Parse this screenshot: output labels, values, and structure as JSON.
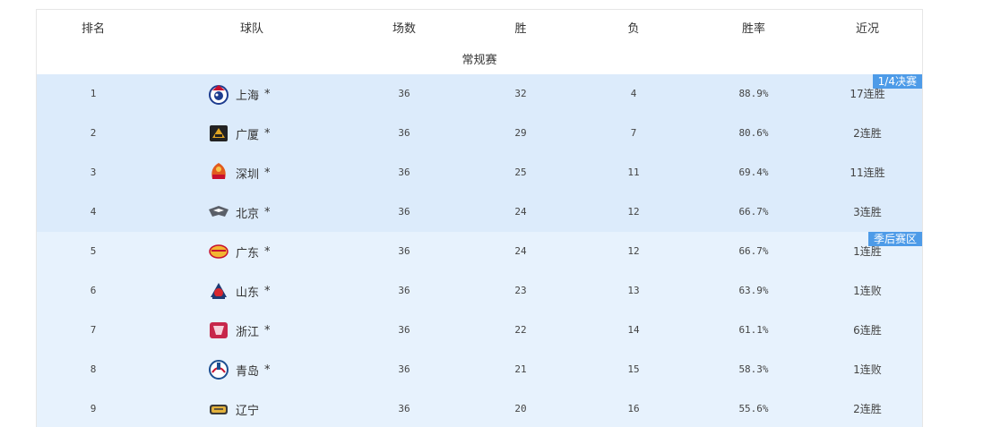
{
  "table": {
    "headers": {
      "rank": "排名",
      "team": "球队",
      "games": "场数",
      "wins": "胜",
      "losses": "负",
      "pct": "胜率",
      "streak": "近况"
    },
    "section_label": "常规赛",
    "zones": {
      "quarterfinal": "1/4决赛",
      "playoff": "季后赛区"
    },
    "rows": [
      {
        "rank": "1",
        "team": "上海",
        "star": "*",
        "games": "36",
        "wins": "32",
        "losses": "4",
        "pct": "88.9%",
        "streak": "17连胜",
        "logo": "shanghai-logo"
      },
      {
        "rank": "2",
        "team": "广厦",
        "star": "*",
        "games": "36",
        "wins": "29",
        "losses": "7",
        "pct": "80.6%",
        "streak": "2连胜",
        "logo": "guangsha-logo"
      },
      {
        "rank": "3",
        "team": "深圳",
        "star": "*",
        "games": "36",
        "wins": "25",
        "losses": "11",
        "pct": "69.4%",
        "streak": "11连胜",
        "logo": "shenzhen-logo"
      },
      {
        "rank": "4",
        "team": "北京",
        "star": "*",
        "games": "36",
        "wins": "24",
        "losses": "12",
        "pct": "66.7%",
        "streak": "3连胜",
        "logo": "beijing-logo"
      },
      {
        "rank": "5",
        "team": "广东",
        "star": "*",
        "games": "36",
        "wins": "24",
        "losses": "12",
        "pct": "66.7%",
        "streak": "1连胜",
        "logo": "guangdong-logo"
      },
      {
        "rank": "6",
        "team": "山东",
        "star": "*",
        "games": "36",
        "wins": "23",
        "losses": "13",
        "pct": "63.9%",
        "streak": "1连败",
        "logo": "shandong-logo"
      },
      {
        "rank": "7",
        "team": "浙江",
        "star": "*",
        "games": "36",
        "wins": "22",
        "losses": "14",
        "pct": "61.1%",
        "streak": "6连胜",
        "logo": "zhejiang-logo"
      },
      {
        "rank": "8",
        "team": "青岛",
        "star": "*",
        "games": "36",
        "wins": "21",
        "losses": "15",
        "pct": "58.3%",
        "streak": "1连败",
        "logo": "qingdao-logo"
      },
      {
        "rank": "9",
        "team": "辽宁",
        "star": "",
        "games": "36",
        "wins": "20",
        "losses": "16",
        "pct": "55.6%",
        "streak": "2连胜",
        "logo": "liaoning-logo"
      }
    ]
  },
  "colors": {
    "quarterfinal_row": "#dcebfb",
    "playoff_row": "#e7f2fd",
    "badge": "#4d9be8"
  }
}
